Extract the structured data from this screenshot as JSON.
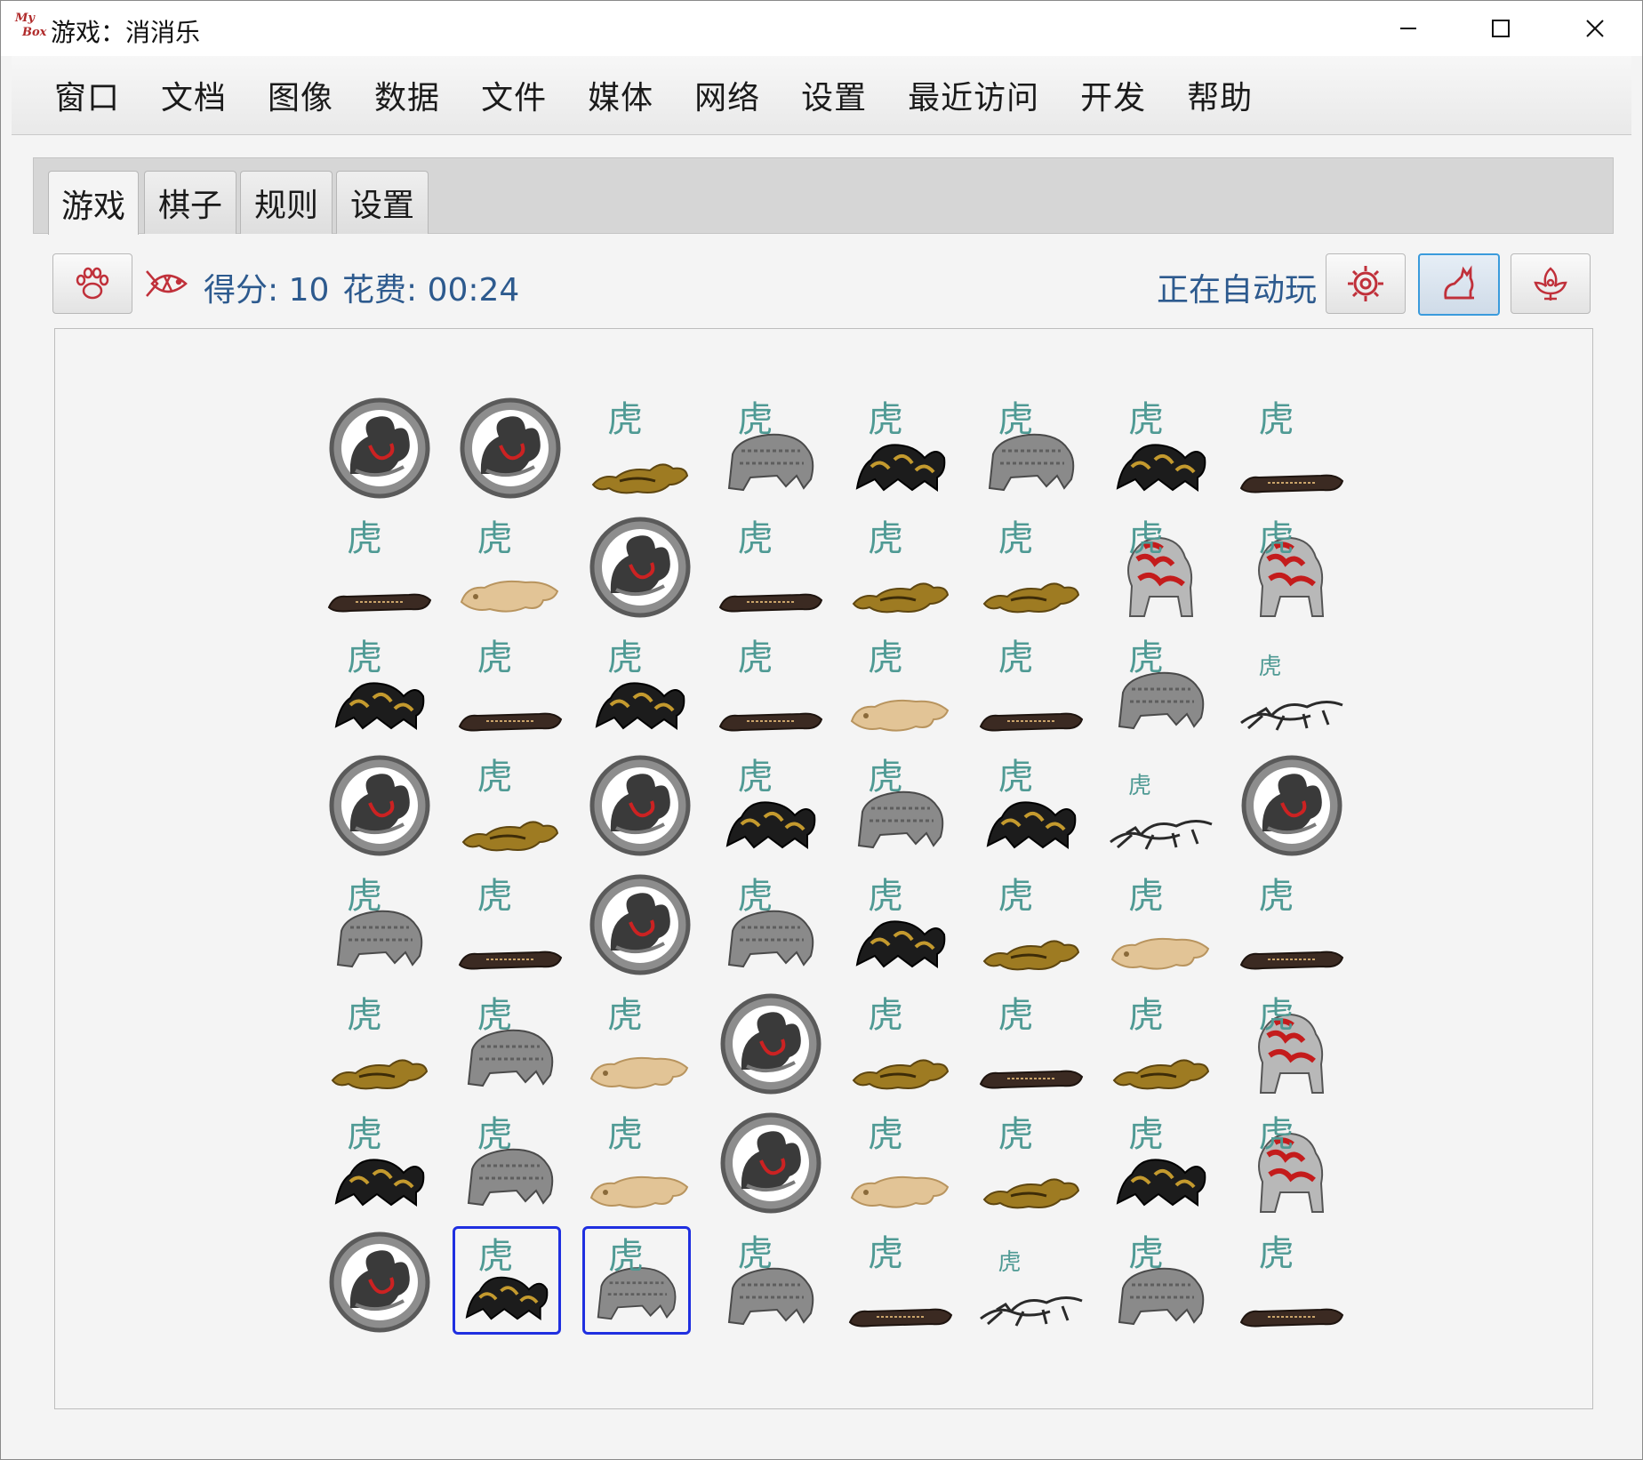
{
  "window": {
    "title": "游戏：消消乐",
    "logo_text_top": "My",
    "logo_text_bottom": "Box"
  },
  "menu": [
    "窗口",
    "文档",
    "图像",
    "数据",
    "文件",
    "媒体",
    "网络",
    "设置",
    "最近访问",
    "开发",
    "帮助"
  ],
  "tabs": [
    "游戏",
    "棋子",
    "规则",
    "设置"
  ],
  "selected_tab": 0,
  "status": {
    "score_text": "得分: 10",
    "cost_text": "花费: 00:24",
    "auto_text": "正在自动玩"
  },
  "toolbar": {
    "left_button_icon": "paw-icon",
    "fish_icon": "fish-icon",
    "right_buttons": [
      "gear-icon",
      "cat-icon",
      "flower-icon"
    ],
    "active_button": "cat-icon"
  },
  "colors": {
    "accent_blue": "#2d5a8e",
    "selection_border": "#1f2fe0",
    "icon_red": "#c0303a",
    "glyph_teal": "#4f9a94"
  },
  "board": {
    "rows": 8,
    "cols": 8,
    "pieces": [
      [
        "disc",
        "disc",
        "gold",
        "gray",
        "black",
        "gray",
        "black",
        "dark"
      ],
      [
        "dark",
        "cream",
        "disc",
        "dark",
        "gold",
        "gold",
        "red",
        "red"
      ],
      [
        "black",
        "dark",
        "black",
        "dark",
        "cream",
        "dark",
        "gray",
        "sketch"
      ],
      [
        "disc",
        "gold",
        "disc",
        "black",
        "gray",
        "black",
        "sketch",
        "disc"
      ],
      [
        "gray",
        "dark",
        "disc",
        "gray",
        "black",
        "gold",
        "cream",
        "dark"
      ],
      [
        "gold",
        "gray",
        "cream",
        "disc",
        "gold",
        "dark",
        "gold",
        "red"
      ],
      [
        "black",
        "gray",
        "cream",
        "disc",
        "cream",
        "gold",
        "black",
        "red"
      ],
      [
        "disc",
        "black",
        "gray",
        "gray",
        "dark",
        "sketch",
        "gray",
        "dark"
      ]
    ],
    "selected": [
      [
        7,
        1
      ],
      [
        7,
        2
      ]
    ]
  }
}
